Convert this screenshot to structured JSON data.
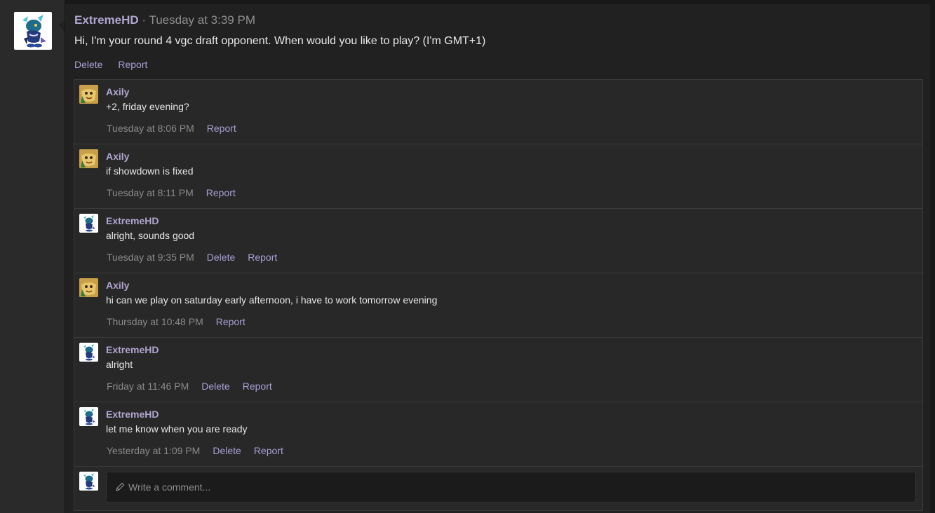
{
  "post": {
    "author": "ExtremeHD",
    "separator": " · ",
    "time": "Tuesday at 3:39 PM",
    "text": "Hi, I'm your round 4 vgc draft opponent. When would you like to play? (I'm GMT+1)",
    "actions": {
      "delete": "Delete",
      "report": "Report"
    }
  },
  "comments": [
    {
      "author": "Axily",
      "avatar": "axily-avatar",
      "text": "+2, friday evening?",
      "time": "Tuesday at 8:06 PM",
      "delete": "",
      "report": "Report"
    },
    {
      "author": "Axily",
      "avatar": "axily-avatar",
      "text": "if showdown is fixed",
      "time": "Tuesday at 8:11 PM",
      "delete": "",
      "report": "Report"
    },
    {
      "author": "ExtremeHD",
      "avatar": "extremehd-avatar",
      "text": "alright, sounds good",
      "time": "Tuesday at 9:35 PM",
      "delete": "Delete",
      "report": "Report"
    },
    {
      "author": "Axily",
      "avatar": "axily-avatar",
      "text": "hi can we play on saturday early afternoon, i have to work tomorrow evening",
      "time": "Thursday at 10:48 PM",
      "delete": "",
      "report": "Report"
    },
    {
      "author": "ExtremeHD",
      "avatar": "extremehd-avatar",
      "text": "alright",
      "time": "Friday at 11:46 PM",
      "delete": "Delete",
      "report": "Report"
    },
    {
      "author": "ExtremeHD",
      "avatar": "extremehd-avatar",
      "text": "let me know when you are ready",
      "time": "Yesterday at 1:09 PM",
      "delete": "Delete",
      "report": "Report"
    }
  ],
  "reply": {
    "placeholder": "Write a comment...",
    "icon": "pencil-icon"
  },
  "colors": {
    "author": "#b1a6d0",
    "link": "#a99fd6",
    "background": "#212121"
  }
}
